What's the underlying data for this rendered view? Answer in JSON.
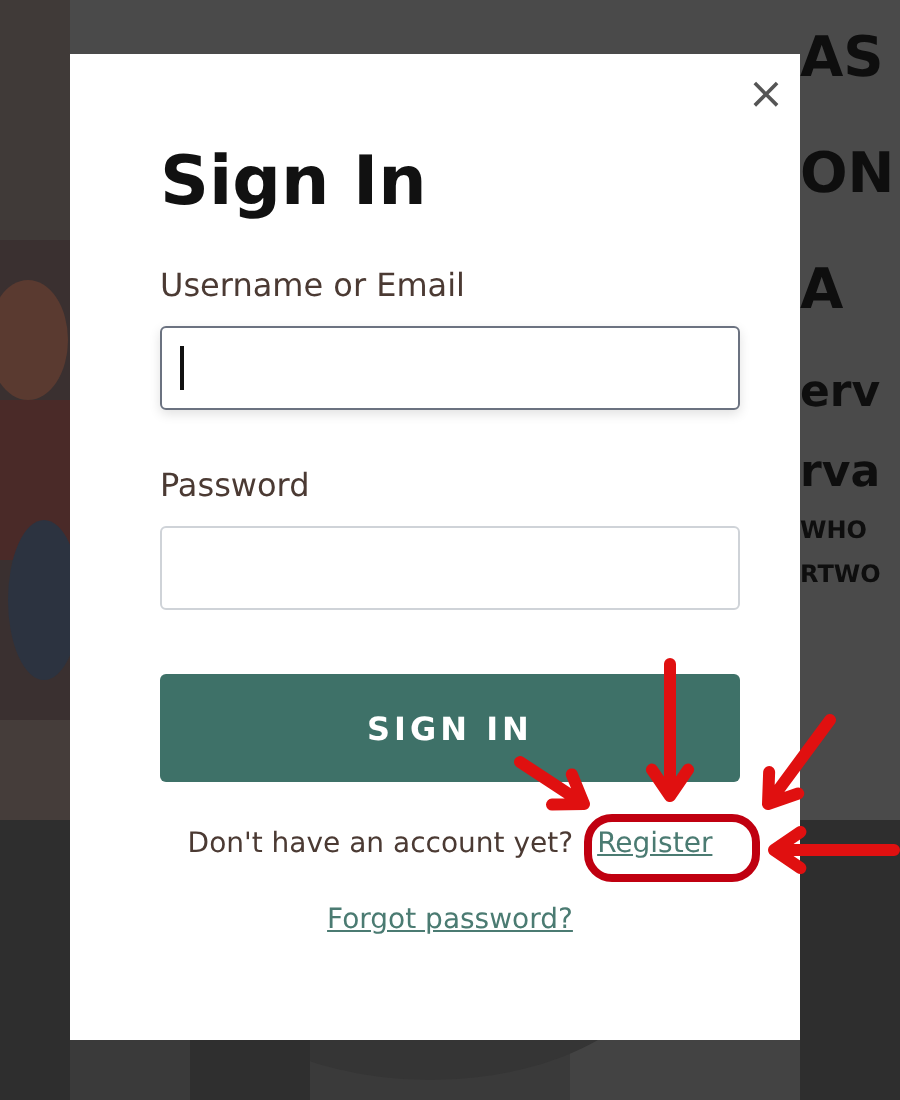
{
  "background": {
    "side_texts": [
      {
        "kind": "big",
        "text": "AS"
      },
      {
        "kind": "big",
        "text": "ON"
      },
      {
        "kind": "big",
        "text": "A"
      },
      {
        "kind": "mid",
        "text": "erv"
      },
      {
        "kind": "mid",
        "text": "rva"
      },
      {
        "kind": "small",
        "text": "WHO"
      },
      {
        "kind": "small",
        "text": "RTWO"
      }
    ]
  },
  "dialog": {
    "title": "Sign In",
    "close": "×",
    "fields": [
      {
        "label": "Username or Email",
        "focused": true
      },
      {
        "label": "Password",
        "focused": false
      }
    ],
    "submit": "SIGN IN",
    "register_prompt": "Don't have an account yet?",
    "register_link": "Register",
    "forgot_link": "Forgot password?"
  }
}
